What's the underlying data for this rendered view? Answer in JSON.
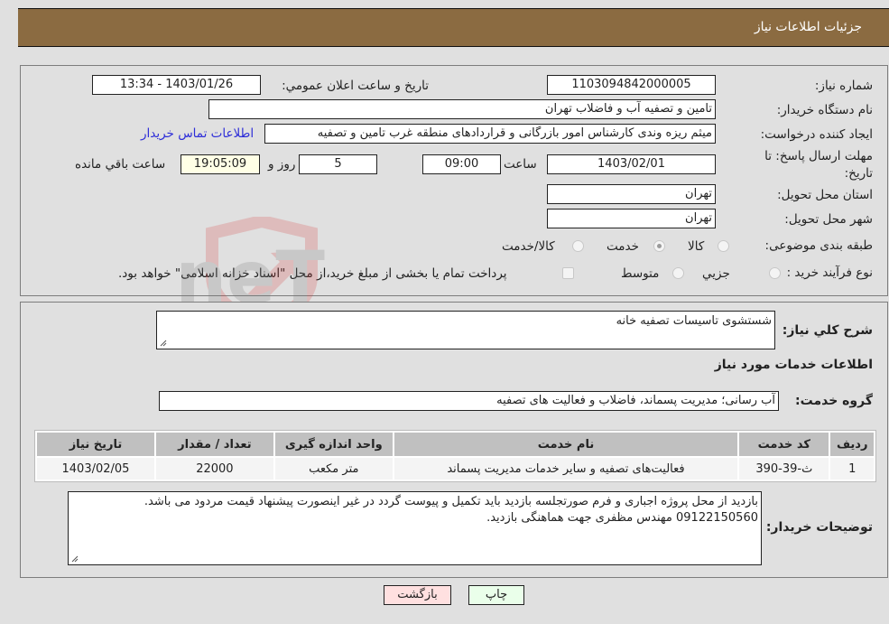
{
  "header": {
    "title": "جزئیات اطلاعات نیاز"
  },
  "need_number": {
    "label": "شماره نیاز:",
    "value": "1103094842000005"
  },
  "announce": {
    "label": "تاريخ و ساعت اعلان عمومي:",
    "value": "1403/01/26 - 13:34"
  },
  "buyer_org": {
    "label": "نام دستگاه خریدار:",
    "value": "تامین و تصفیه آب و فاضلاب تهران"
  },
  "requester": {
    "label": "ایجاد کننده درخواست:",
    "value": "میثم ریزه وندی کارشناس امور بازرگانی و قراردادهای منطقه غرب تامین و تصفیه",
    "contact_link": "اطلاعات تماس خریدار"
  },
  "deadline": {
    "label": "مهلت ارسال پاسخ: تا تاریخ:",
    "date": "1403/02/01",
    "time_label": "ساعت",
    "time": "09:00",
    "days": "5",
    "days_label": "روز و",
    "remaining": "19:05:09",
    "remaining_label": "ساعت باقي مانده"
  },
  "province": {
    "label": "استان محل تحویل:",
    "value": "تهران"
  },
  "city": {
    "label": "شهر محل تحویل:",
    "value": "تهران"
  },
  "category": {
    "label": "طبقه بندی موضوعی:",
    "options": [
      {
        "label": "کالا",
        "checked": false
      },
      {
        "label": "خدمت",
        "checked": true
      },
      {
        "label": "کالا/خدمت",
        "checked": false
      }
    ]
  },
  "purchase_type": {
    "label": "نوع فرآیند خرید :",
    "options": [
      {
        "label": "جزيي",
        "checked": false
      },
      {
        "label": "متوسط",
        "checked": false
      }
    ],
    "treasury_note": "پرداخت تمام یا بخشی از مبلغ خرید،از محل \"اسناد خزانه اسلامی\" خواهد بود."
  },
  "description": {
    "label": "شرح کلي نياز:",
    "value": "شستشوی تاسیسات تصفیه خانه"
  },
  "services_heading": "اطلاعات خدمات مورد نیاز",
  "service_group": {
    "label": "گروه خدمت:",
    "value": "آب رسانی؛ مدیریت پسماند، فاضلاب و فعالیت های تصفیه"
  },
  "table": {
    "headers": [
      "رديف",
      "کد خدمت",
      "نام خدمت",
      "واحد اندازه گیری",
      "تعداد / مقدار",
      "تاریخ نیاز"
    ],
    "rows": [
      [
        "1",
        "ث-39-390",
        "فعالیت‌های تصفیه و سایر خدمات مدیریت پسماند",
        "متر مکعب",
        "22000",
        "1403/02/05"
      ]
    ]
  },
  "buyer_notes": {
    "label": "توضیحات خریدار:",
    "lines": [
      "بازدید از محل پروژه اجباری و فرم صورتجلسه بازدید باید تکمیل و پیوست گردد در غیر اینصورت پیشنهاد قیمت مردود می باشد.",
      "09122150560  مهندس مظفری جهت هماهنگی بازدید."
    ]
  },
  "buttons": {
    "print": "چاپ",
    "back": "بازگشت"
  },
  "watermark": {
    "text": "AriaTender.neT"
  },
  "colors": {
    "header_bg": "#8b6b41",
    "back_btn": "#ffe0e0",
    "print_btn": "#eaffea",
    "link": "#2d2dd8"
  }
}
